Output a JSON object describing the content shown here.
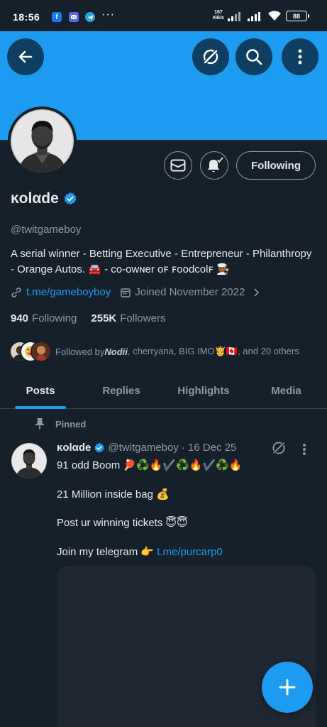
{
  "status_bar": {
    "time": "18:56",
    "net_speed_value": "167",
    "net_speed_unit": "KB/s",
    "battery": "88",
    "more": "···"
  },
  "profile": {
    "display_name": "ĸolαde",
    "handle": "@twitgameboy",
    "bio": "A serial winner - Betting Executive - Entrepreneur - Philanthropy - Orange Autos. 🚘 - co-owɴer oꜰ ꜰoodcolꜰ 🧑🏾‍🍳",
    "link": "t.me/gameboyboy",
    "joined": "Joined November 2022",
    "following_count": "940",
    "following_label": "Following",
    "followers_count": "255K",
    "followers_label": "Followers",
    "follow_button": "Following",
    "followed_by_prefix": "Followed by ",
    "followed_by_first": "Nodii",
    "followed_by_rest": ", cherryana, BIG IMO🤴🇨🇦, and 20 others"
  },
  "tabs": [
    {
      "label": "Posts",
      "active": true
    },
    {
      "label": "Replies",
      "active": false
    },
    {
      "label": "Highlights",
      "active": false
    },
    {
      "label": "Media",
      "active": false
    }
  ],
  "pinned_tweet": {
    "pinned_label": "Pinned",
    "author_name": "ĸolαde",
    "author_handle": "@twitgameboy",
    "date": "· 16 Dec 25",
    "line1": "91 odd Boom 🏓♻️🔥✔️♻️🔥✔️♻️🔥",
    "line2": "21 Million inside bag 💰",
    "line3": "Post ur winning tickets 😇😇",
    "line4_text": "Join my telegram 👉 ",
    "line4_link": "t.me/purcarp0"
  },
  "icons": {
    "back": "arrow-left-icon",
    "grok": "grok-icon",
    "search": "search-icon",
    "more": "more-vertical-icon",
    "mail": "mail-icon",
    "bell": "bell-icon",
    "verified": "verified-badge-icon",
    "link": "link-icon",
    "calendar": "calendar-icon",
    "pin": "pin-icon",
    "compose": "plus-icon"
  },
  "colors": {
    "background": "#15202b",
    "banner": "#1d9bf0",
    "accent": "#1d9bf0",
    "secondary_text": "#8b98a5"
  }
}
